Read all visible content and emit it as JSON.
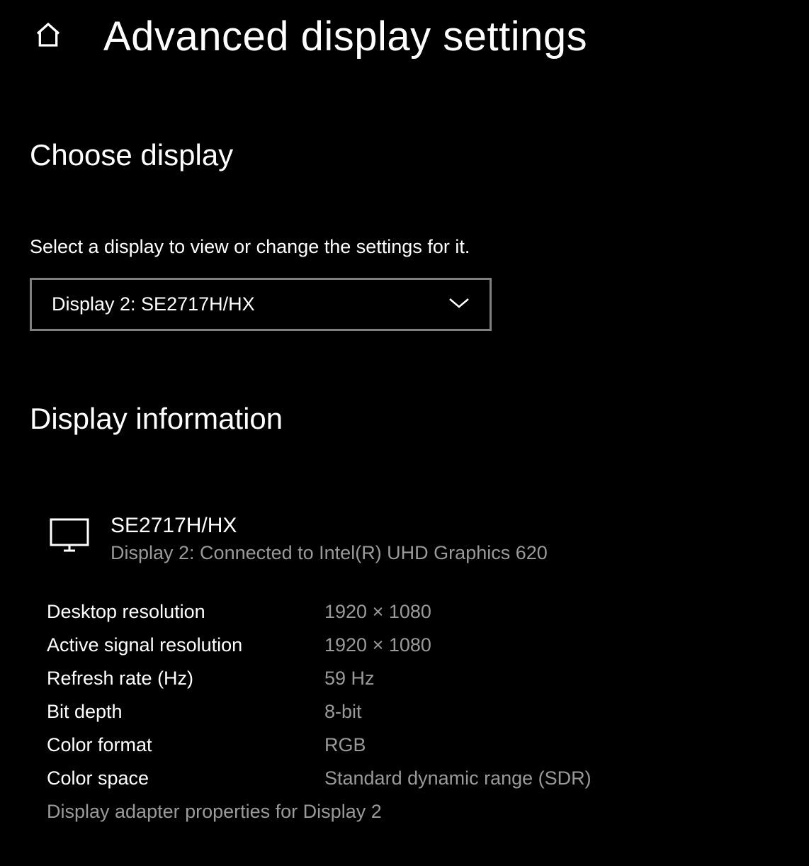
{
  "header": {
    "title": "Advanced display settings"
  },
  "choose": {
    "heading": "Choose display",
    "instruction": "Select a display to view or change the settings for it.",
    "selected": "Display 2: SE2717H/HX"
  },
  "info": {
    "heading": "Display information",
    "device_name": "SE2717H/HX",
    "device_conn": "Display 2: Connected to Intel(R) UHD Graphics 620",
    "rows": [
      {
        "key": "Desktop resolution",
        "val": "1920 × 1080"
      },
      {
        "key": "Active signal resolution",
        "val": "1920 × 1080"
      },
      {
        "key": "Refresh rate (Hz)",
        "val": "59 Hz"
      },
      {
        "key": "Bit depth",
        "val": "8-bit"
      },
      {
        "key": "Color format",
        "val": "RGB"
      },
      {
        "key": "Color space",
        "val": "Standard dynamic range (SDR)"
      }
    ],
    "adapter_link": "Display adapter properties for Display 2"
  }
}
